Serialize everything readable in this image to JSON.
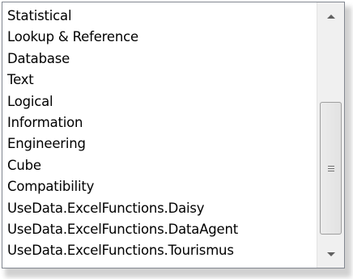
{
  "listbox": {
    "items": [
      "Statistical",
      "Lookup & Reference",
      "Database",
      "Text",
      "Logical",
      "Information",
      "Engineering",
      "Cube",
      "Compatibility",
      "UseData.ExcelFunctions.Daisy",
      "UseData.ExcelFunctions.DataAgent",
      "UseData.ExcelFunctions.Tourismus"
    ]
  },
  "scrollbar": {
    "position_fraction": 1.0,
    "up_icon": "scroll-up-arrow",
    "down_icon": "scroll-down-arrow",
    "thumb_icon": "grip-lines"
  }
}
